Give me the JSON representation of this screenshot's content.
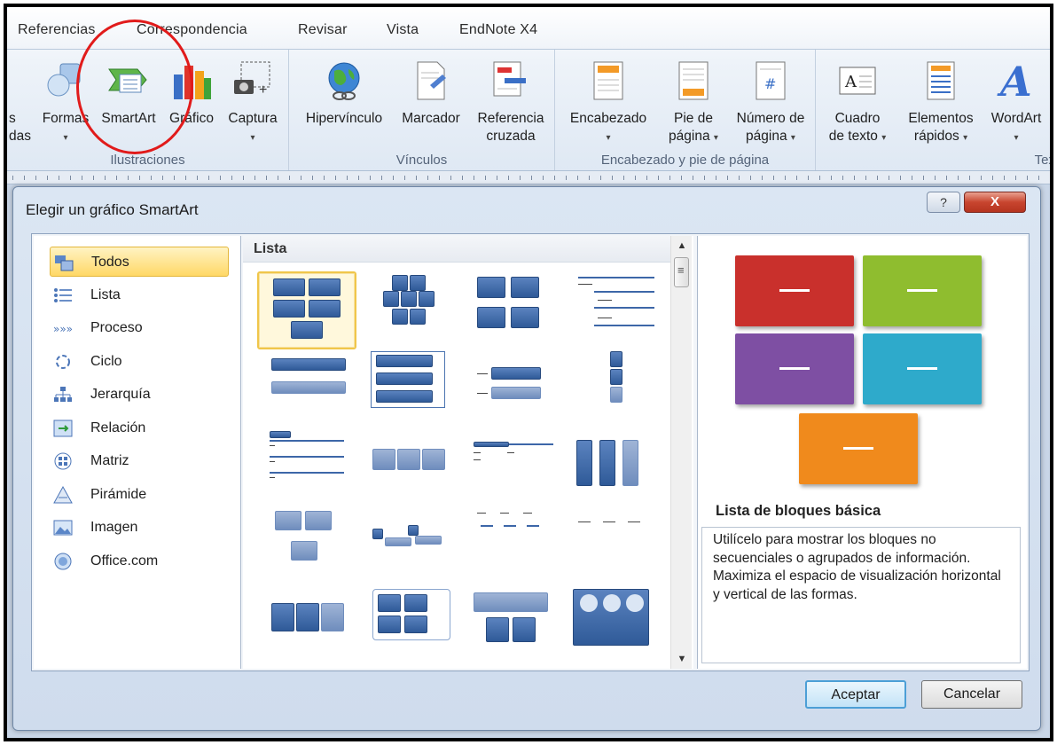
{
  "ribbon": {
    "tabs": [
      "Referencias",
      "Correspondencia",
      "Revisar",
      "Vista",
      "EndNote X4"
    ],
    "ilustraciones": {
      "label": "Ilustraciones",
      "cut_text_1": "s",
      "cut_text_2": "das",
      "buttons": [
        "Formas",
        "SmartArt",
        "Gráfico",
        "Captura"
      ]
    },
    "vinculos": {
      "label": "Vínculos",
      "hipervinculo": "Hipervínculo",
      "marcador": "Marcador",
      "referencia_line1": "Referencia",
      "referencia_line2": "cruzada"
    },
    "encabezado": {
      "label": "Encabezado y pie de página",
      "encabezado": "Encabezado",
      "pie_line1": "Pie de",
      "pie_line2": "página",
      "numero_line1": "Número de",
      "numero_line2": "página"
    },
    "texto": {
      "label_cut": "Tex",
      "cuadro_line1": "Cuadro",
      "cuadro_line2": "de texto",
      "elementos_line1": "Elementos",
      "elementos_line2": "rápidos",
      "wordart": "WordArt"
    },
    "caret": "▾"
  },
  "dialog": {
    "title": "Elegir un gráfico SmartArt",
    "help": "?",
    "close": "X",
    "categories": [
      {
        "label": "Todos",
        "icon": "all-icon",
        "selected": true
      },
      {
        "label": "Lista",
        "icon": "list-icon"
      },
      {
        "label": "Proceso",
        "icon": "process-icon"
      },
      {
        "label": "Ciclo",
        "icon": "cycle-icon"
      },
      {
        "label": "Jerarquía",
        "icon": "hierarchy-icon"
      },
      {
        "label": "Relación",
        "icon": "relationship-icon"
      },
      {
        "label": "Matriz",
        "icon": "matrix-icon"
      },
      {
        "label": "Pirámide",
        "icon": "pyramid-icon"
      },
      {
        "label": "Imagen",
        "icon": "picture-icon"
      },
      {
        "label": "Office.com",
        "icon": "office-com-icon"
      }
    ],
    "gallery_title": "Lista",
    "preview": {
      "title": "Lista de bloques básica",
      "description": "Utilícelo para mostrar los bloques no secuenciales o agrupados de información. Maximiza el espacio de visualización horizontal y vertical de las formas.",
      "colors": [
        "#c9302c",
        "#8fbd2f",
        "#7e4fa3",
        "#2eaacb",
        "#f08a1c"
      ]
    },
    "ok": "Aceptar",
    "cancel": "Cancelar"
  },
  "accent": {
    "highlight_circle": "#e11b1b",
    "selection": "#ffd866"
  }
}
